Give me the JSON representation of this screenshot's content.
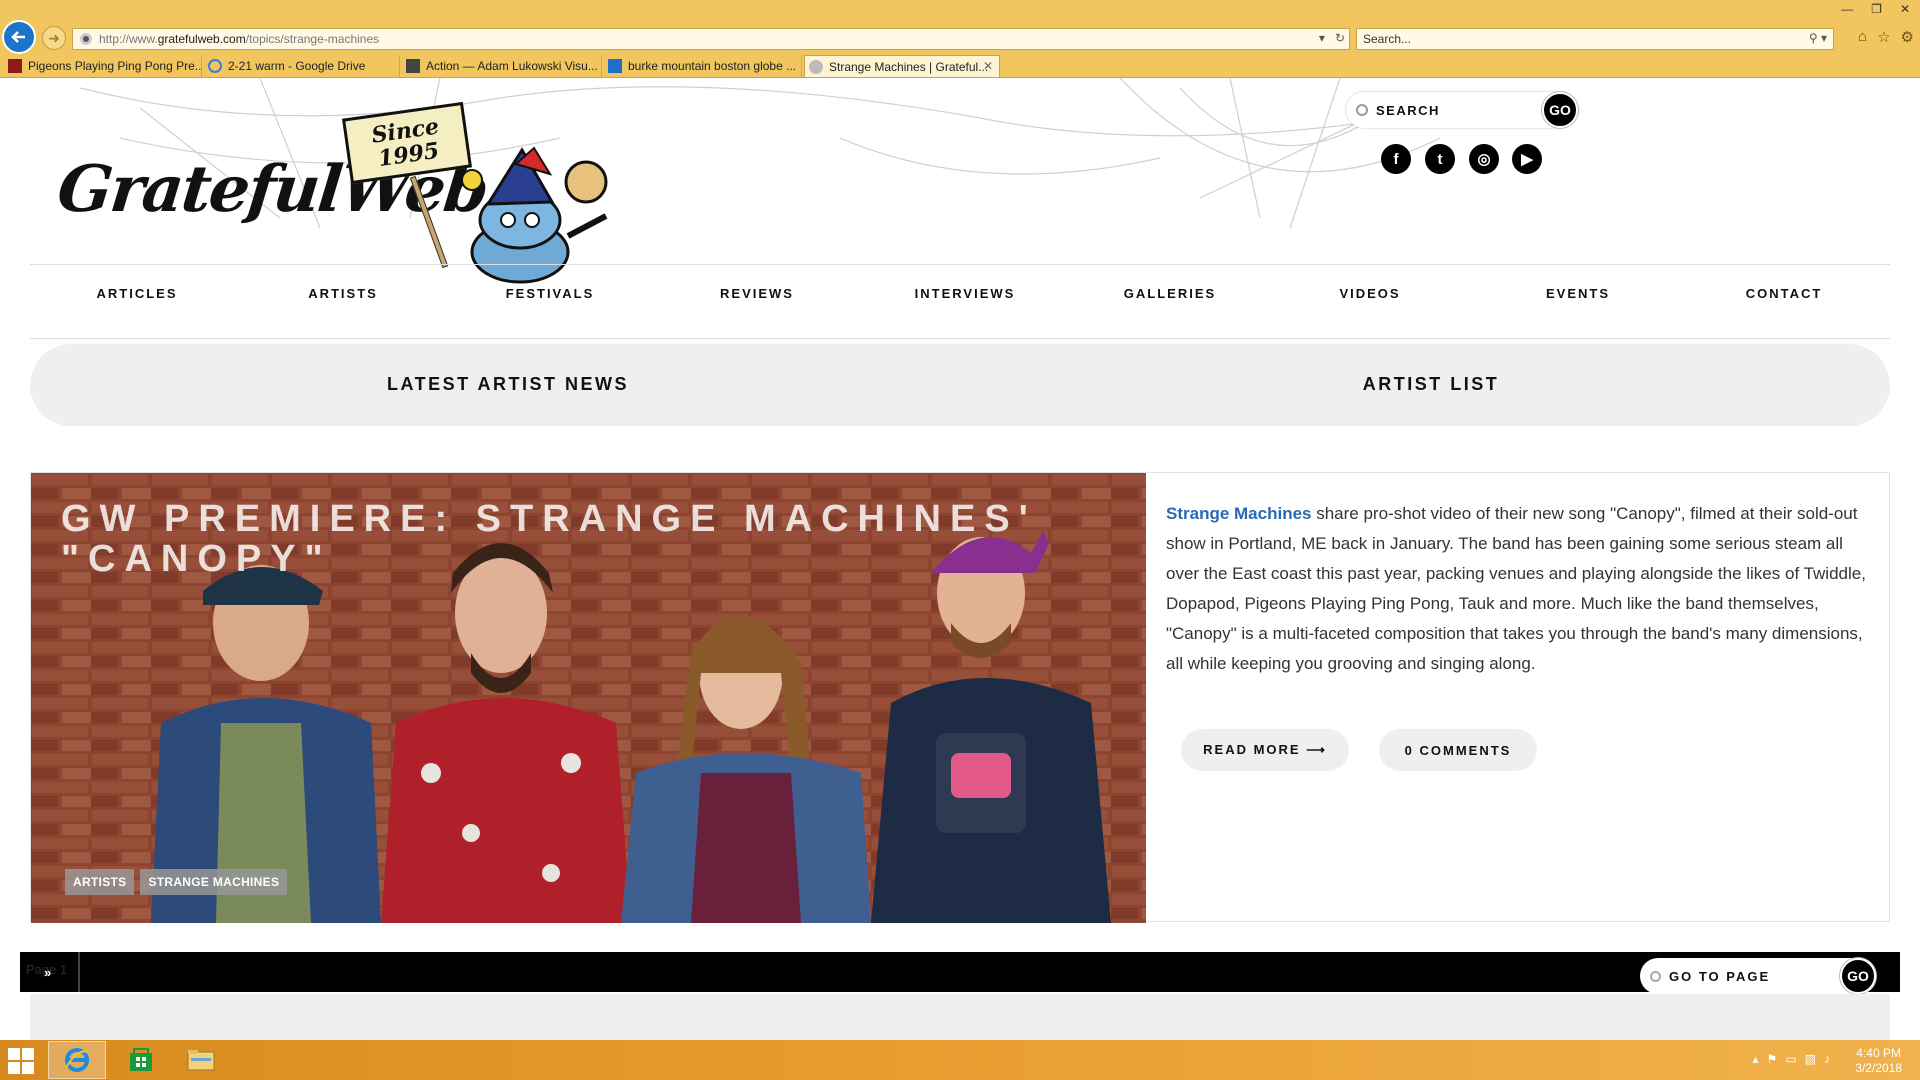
{
  "browser": {
    "url_prefix": "http://www.",
    "url_domain": "gratefulweb.com",
    "url_path": "/topics/strange-machines",
    "search_placeholder": "Search...",
    "tabs": [
      {
        "label": "Pigeons Playing Ping Pong Pre...",
        "icon": "w-icon",
        "active": false
      },
      {
        "label": "2-21 warm - Google Drive",
        "icon": "ie-icon",
        "active": false
      },
      {
        "label": "Action — Adam Lukowski Visu...",
        "icon": "cube-icon",
        "active": false
      },
      {
        "label": "burke mountain boston globe ...",
        "icon": "bing-icon",
        "active": false
      },
      {
        "label": "Strange Machines | Grateful...",
        "icon": "gratefulweb-icon",
        "active": true
      }
    ]
  },
  "site": {
    "logo_text": "GratefulWeb",
    "since_line1": "Since",
    "since_line2": "1995",
    "search_label": "SEARCH",
    "search_go": "GO",
    "social": [
      {
        "name": "facebook",
        "glyph": "f"
      },
      {
        "name": "twitter",
        "glyph": "t"
      },
      {
        "name": "instagram",
        "glyph": "◎"
      },
      {
        "name": "youtube",
        "glyph": "▶"
      }
    ]
  },
  "nav": {
    "items": [
      "ARTICLES",
      "ARTISTS",
      "FESTIVALS",
      "REVIEWS",
      "INTERVIEWS",
      "GALLERIES",
      "VIDEOS",
      "EVENTS",
      "CONTACT"
    ]
  },
  "subnav": {
    "latest": "LATEST ARTIST NEWS",
    "list": "ARTIST LIST"
  },
  "article": {
    "headline": "GW Premiere: Strange Machines' \"Canopy\"",
    "tags": [
      "ARTISTS",
      "STRANGE MACHINES"
    ],
    "excerpt_link": "Strange Machines",
    "excerpt_body": " share pro-shot video of their new song \"Canopy\", filmed at their sold-out show in Portland, ME back in January. The band has been gaining some serious steam all over the East coast this past year, packing venues and playing alongside the likes of Twiddle, Dopapod, Pigeons Playing Ping Pong, Tauk and more. Much like the band themselves, \"Canopy\" is a multi-faceted composition that takes you through the band's many dimensions, all while keeping you grooving and singing along.",
    "read_more": "READ MORE ⟶",
    "comments": "0 COMMENTS"
  },
  "pager": {
    "page_label": "Page 1",
    "next": "»",
    "goto_label": "GO TO PAGE",
    "goto_go": "GO"
  },
  "taskbar": {
    "time": "4:40 PM",
    "date": "3/2/2018"
  },
  "colors": {
    "ie_chrome": "#f1c65e",
    "link_blue": "#2a6ab3",
    "taskbar": "#e79a2c"
  }
}
